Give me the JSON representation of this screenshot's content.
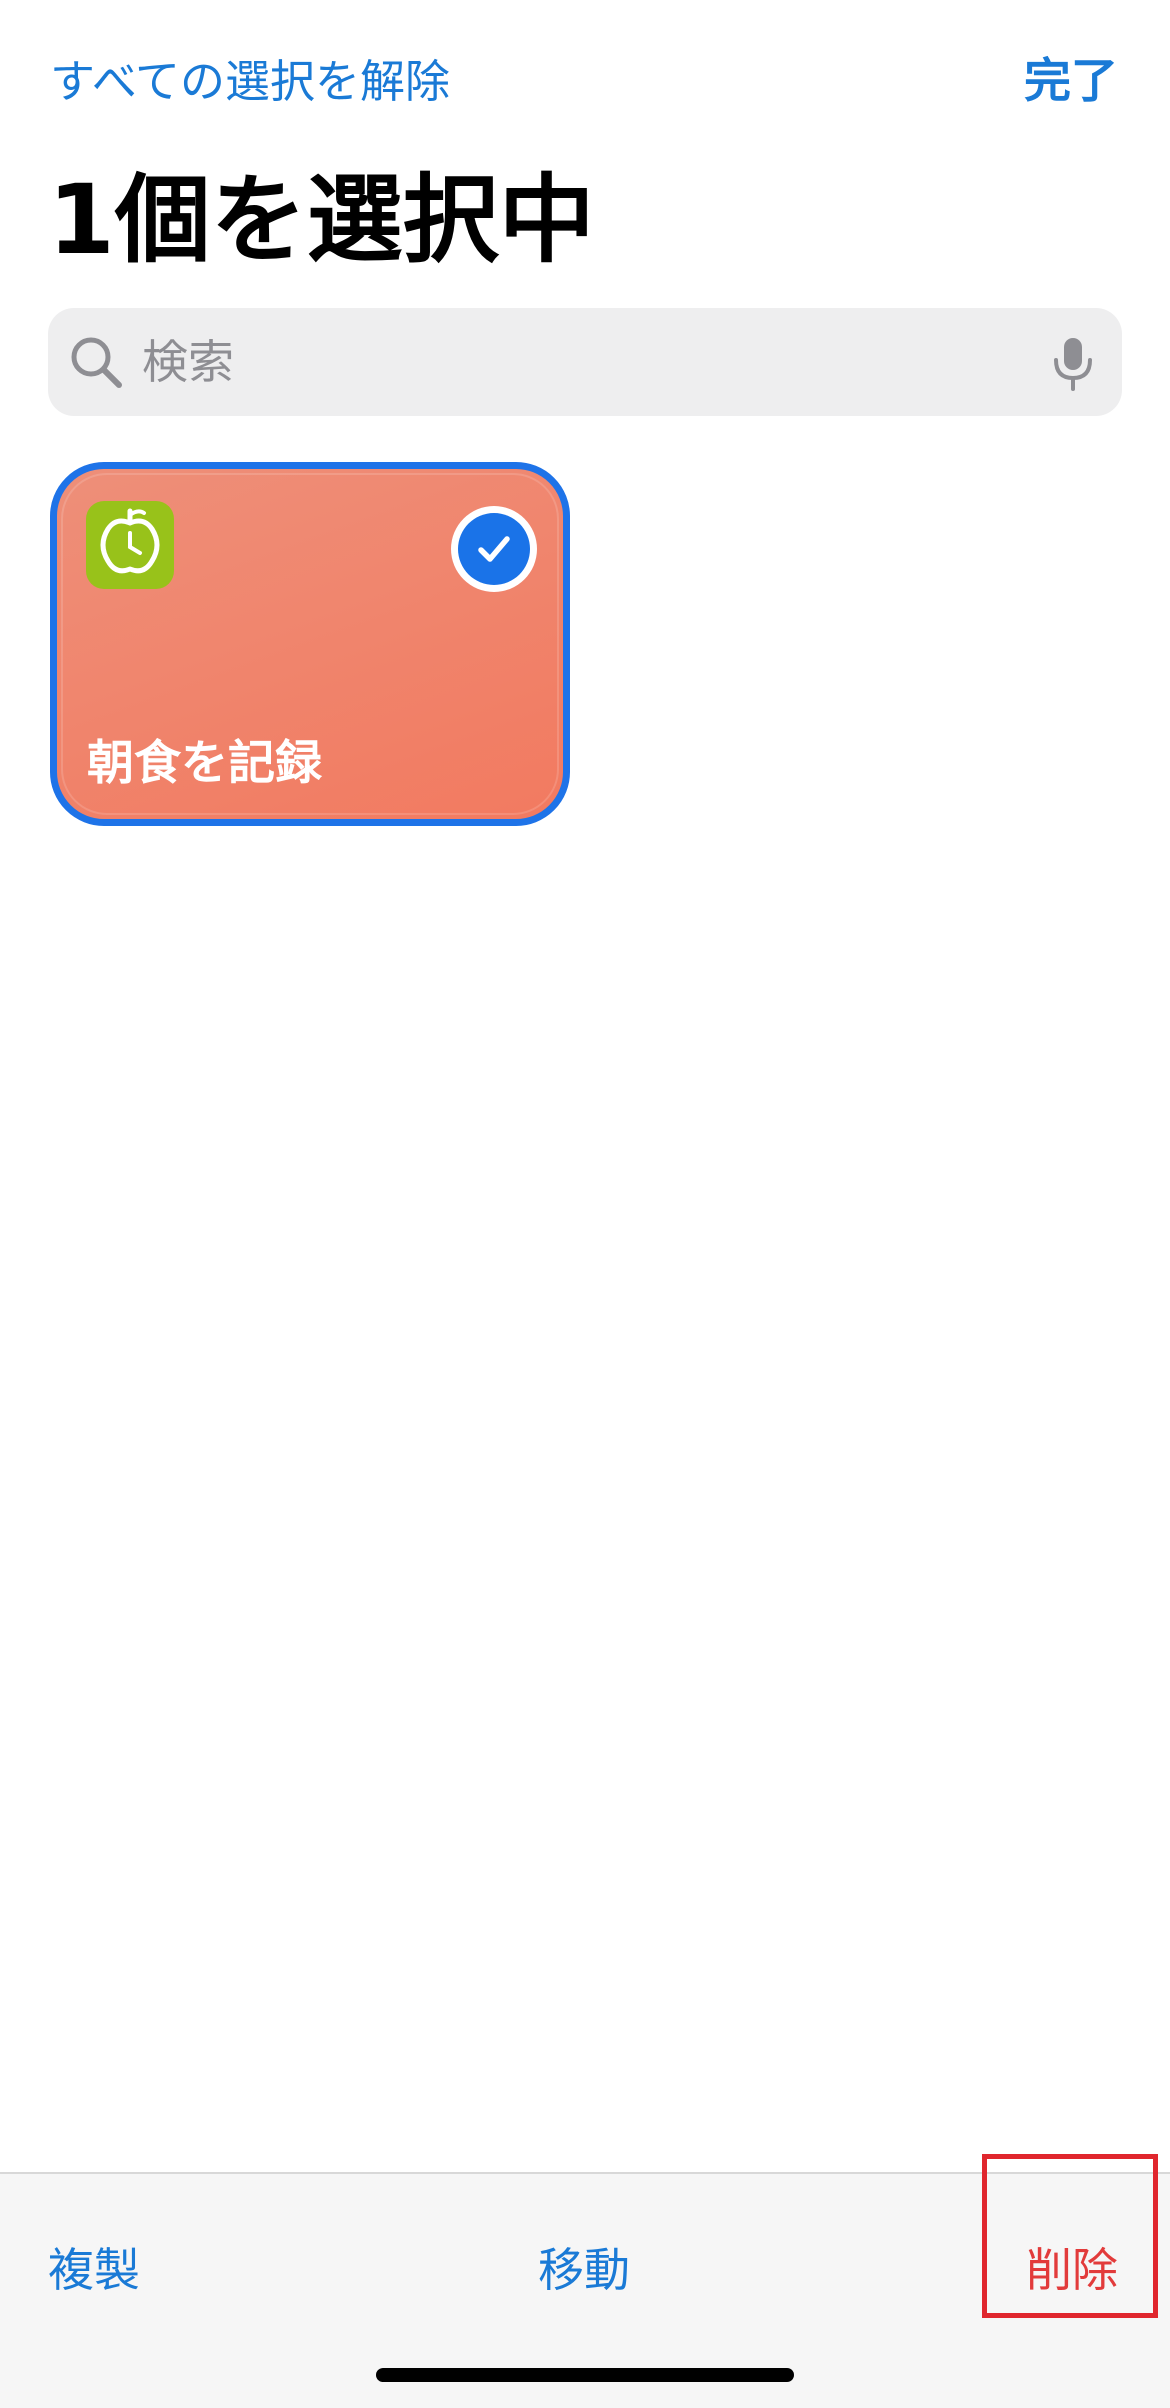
{
  "nav": {
    "deselect_all": "すべての選択を解除",
    "done": "完了"
  },
  "title": "1個を選択中",
  "search": {
    "placeholder": "検索",
    "value": ""
  },
  "shortcuts": [
    {
      "label": "朝食を記録",
      "selected": true,
      "icon": "apple-clock-icon",
      "card_color": "#f27a60",
      "app_icon_color": "#98c21a"
    }
  ],
  "toolbar": {
    "duplicate": "複製",
    "move": "移動",
    "delete": "削除"
  },
  "colors": {
    "accent": "#1a7ad6",
    "destructive": "#e23b3b",
    "selection_border": "#1e73e8"
  }
}
